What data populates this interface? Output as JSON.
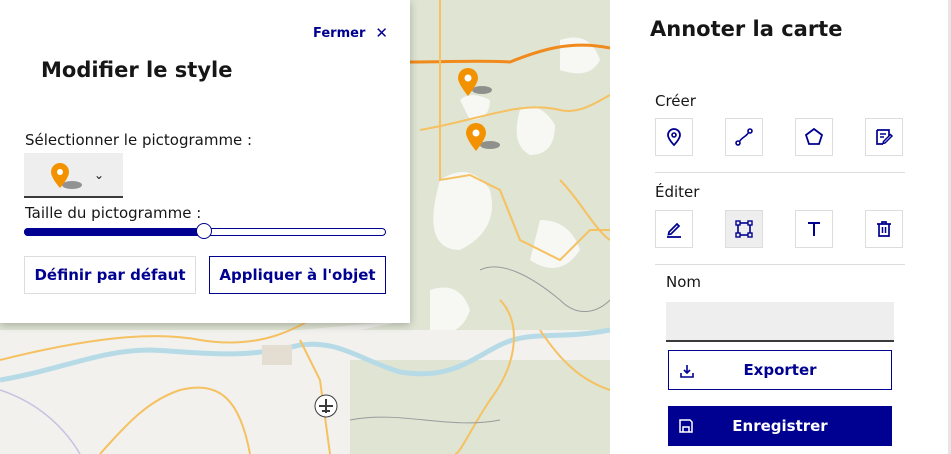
{
  "style_modal": {
    "close_label": "Fermer",
    "close_symbol": "✕",
    "title": "Modifier le style",
    "pictogram_label": "Sélectionner le pictogramme :",
    "pictogram_icon": "orange-map-pin-icon",
    "size_label": "Taille du pictogramme :",
    "size_level_fraction": 0.5,
    "default_button": "Définir par défaut",
    "apply_button": "Appliquer à l'objet"
  },
  "annotate_panel": {
    "title": "Annoter la carte",
    "create_label": "Créer",
    "create_tools": [
      "point-icon",
      "line-icon",
      "polygon-icon",
      "text-note-icon"
    ],
    "edit_label": "Éditer",
    "edit_tools": [
      "edit-pencil-icon",
      "select-vertices-icon",
      "text-icon",
      "trash-icon"
    ],
    "name_label": "Nom",
    "name_value": "",
    "export_button": "Exporter",
    "save_button": "Enregistrer"
  },
  "colors": {
    "primary": "#000091",
    "marker": "#f39200",
    "map_forest": "#dfe4d3",
    "map_road": "#f5c161",
    "map_river": "#b7dbe6"
  }
}
